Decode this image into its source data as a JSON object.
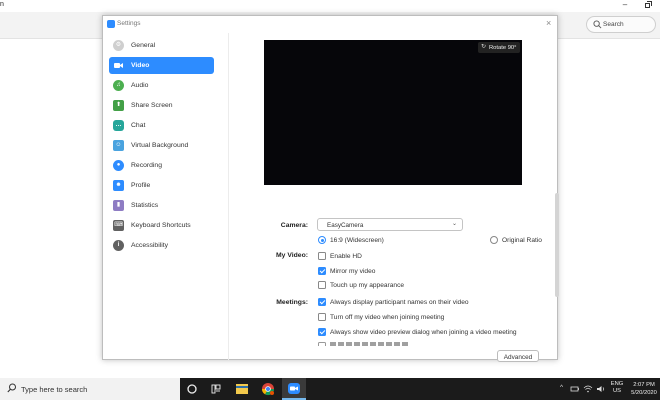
{
  "background": {
    "title_fragment": "n",
    "minimize_glyph": "–",
    "search_label": "Search"
  },
  "dialog": {
    "title": "Settings",
    "close_glyph": "×"
  },
  "sidebar": {
    "items": [
      {
        "label": "General",
        "icon": "gear-icon",
        "color": "#bdbdbd",
        "glyph": "⚙"
      },
      {
        "label": "Video",
        "icon": "video-camera-icon",
        "color": "#ffffff",
        "glyph": "▶"
      },
      {
        "label": "Audio",
        "icon": "headphones-icon",
        "color": "#4caf50",
        "glyph": "♫"
      },
      {
        "label": "Share Screen",
        "icon": "share-screen-icon",
        "color": "#43a047",
        "glyph": "⬆"
      },
      {
        "label": "Chat",
        "icon": "chat-bubble-icon",
        "color": "#26a69a",
        "glyph": "…"
      },
      {
        "label": "Virtual Background",
        "icon": "person-background-icon",
        "color": "#4aa3df",
        "glyph": "☺"
      },
      {
        "label": "Recording",
        "icon": "record-icon",
        "color": "#2d8cff",
        "glyph": "●"
      },
      {
        "label": "Profile",
        "icon": "profile-icon",
        "color": "#2d8cff",
        "glyph": "☻"
      },
      {
        "label": "Statistics",
        "icon": "statistics-bars-icon",
        "color": "#8e7cc3",
        "glyph": "▮"
      },
      {
        "label": "Keyboard Shortcuts",
        "icon": "keyboard-icon",
        "color": "#616161",
        "glyph": "⌨"
      },
      {
        "label": "Accessibility",
        "icon": "accessibility-icon",
        "color": "#616161",
        "glyph": "i"
      }
    ]
  },
  "video": {
    "rotate_label": "Rotate 90°",
    "camera_label": "Camera:",
    "camera_value": "EasyCamera",
    "aspect_options": [
      "16:9 (Widescreen)",
      "Original Ratio"
    ],
    "my_video_label": "My Video:",
    "my_video_options": [
      {
        "label": "Enable HD",
        "checked": false
      },
      {
        "label": "Mirror my video",
        "checked": true
      },
      {
        "label": "Touch up my appearance",
        "checked": false
      }
    ],
    "meetings_label": "Meetings:",
    "meetings_options": [
      {
        "label": "Always display participant names on their video",
        "checked": true
      },
      {
        "label": "Turn off my video when joining meeting",
        "checked": false
      },
      {
        "label": "Always show video preview dialog when joining a video meeting",
        "checked": true
      }
    ],
    "advanced_label": "Advanced"
  },
  "taskbar": {
    "search_placeholder": "Type here to search",
    "lang_top": "ENG",
    "lang_bottom": "US",
    "time": "2:07 PM",
    "date": "5/20/2020",
    "tray_chevron": "^"
  },
  "colors": {
    "accent": "#2d8cff",
    "taskbar": "#1b1b1b"
  }
}
